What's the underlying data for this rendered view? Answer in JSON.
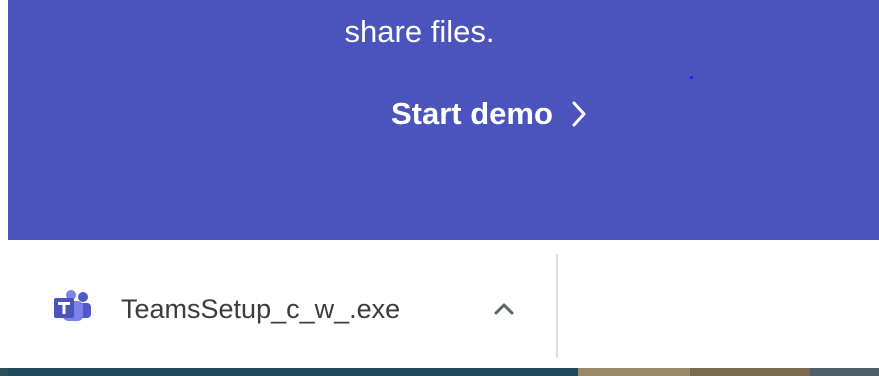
{
  "hero": {
    "text": "share files.",
    "cta_label": "Start demo",
    "background_color": "#4b53bc",
    "cta_icon": "chevron-right-icon"
  },
  "download_shelf": {
    "items": [
      {
        "file_name": "TeamsSetup_c_w_.exe",
        "icon": "microsoft-teams-icon",
        "menu_icon": "chevron-up-icon"
      }
    ]
  }
}
